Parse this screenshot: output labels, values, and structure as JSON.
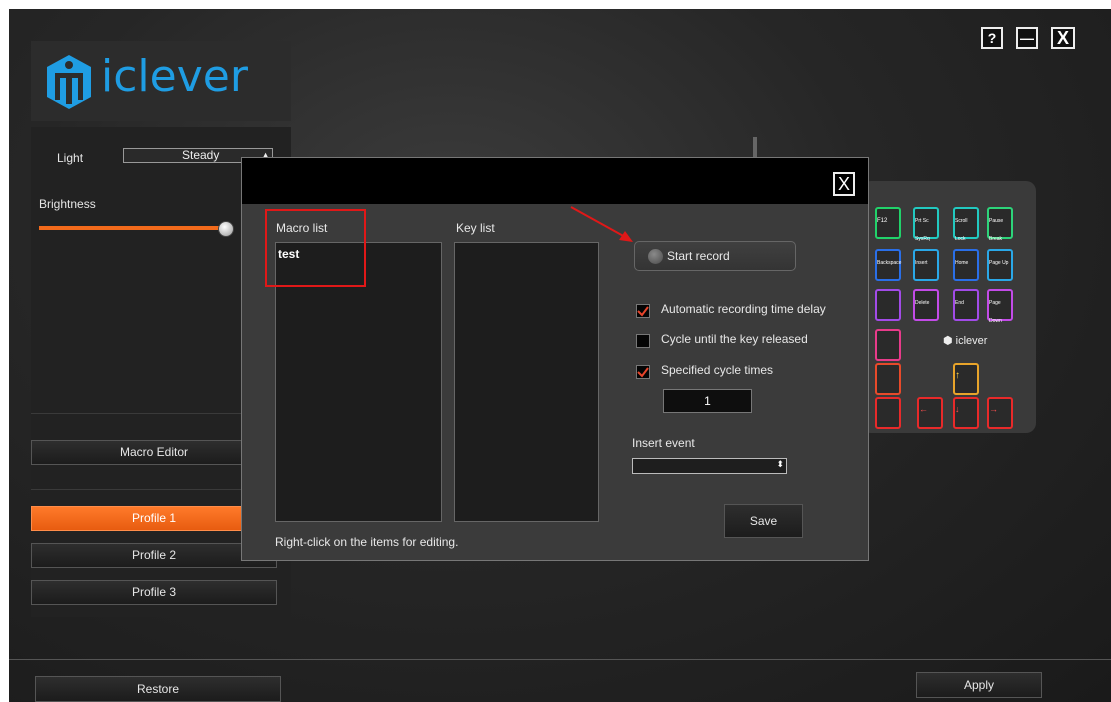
{
  "window": {
    "help_label": "?",
    "minimize_label": "—",
    "close_label": "X"
  },
  "logo": {
    "brand": "iclever"
  },
  "sidebar": {
    "light_label": "Light",
    "light_value": "Steady",
    "brightness_label": "Brightness",
    "brightness_level": 0.95,
    "macro_editor_label": "Macro Editor",
    "profiles": [
      "Profile 1",
      "Profile 2",
      "Profile 3"
    ],
    "active_profile": 0
  },
  "footer": {
    "restore_label": "Restore",
    "apply_label": "Apply"
  },
  "keyboard": {
    "keys": [
      "F12",
      "Prt Sc SysRq",
      "Scroll Lock",
      "Pause Break",
      "Backspace",
      "Insert",
      "Home",
      "Page Up",
      "Delete",
      "End",
      "Page Down",
      "↑",
      "←",
      "↓",
      "→"
    ],
    "logo": "iclever"
  },
  "dialog": {
    "close_label": "X",
    "macro_list_label": "Macro list",
    "macro_items": [
      "test"
    ],
    "key_list_label": "Key list",
    "start_record_label": "Start record",
    "options": [
      {
        "label": "Automatic recording time delay",
        "checked": true
      },
      {
        "label": "Cycle until the key released",
        "checked": false
      },
      {
        "label": "Specified cycle times",
        "checked": true
      }
    ],
    "cycle_times": "1",
    "insert_event_label": "Insert event",
    "insert_event_value": "",
    "save_label": "Save",
    "hint": "Right-click on the items for editing."
  },
  "colors": {
    "accent": "#f26a1b",
    "brand": "#1f9de3",
    "highlight": "#e01818"
  }
}
